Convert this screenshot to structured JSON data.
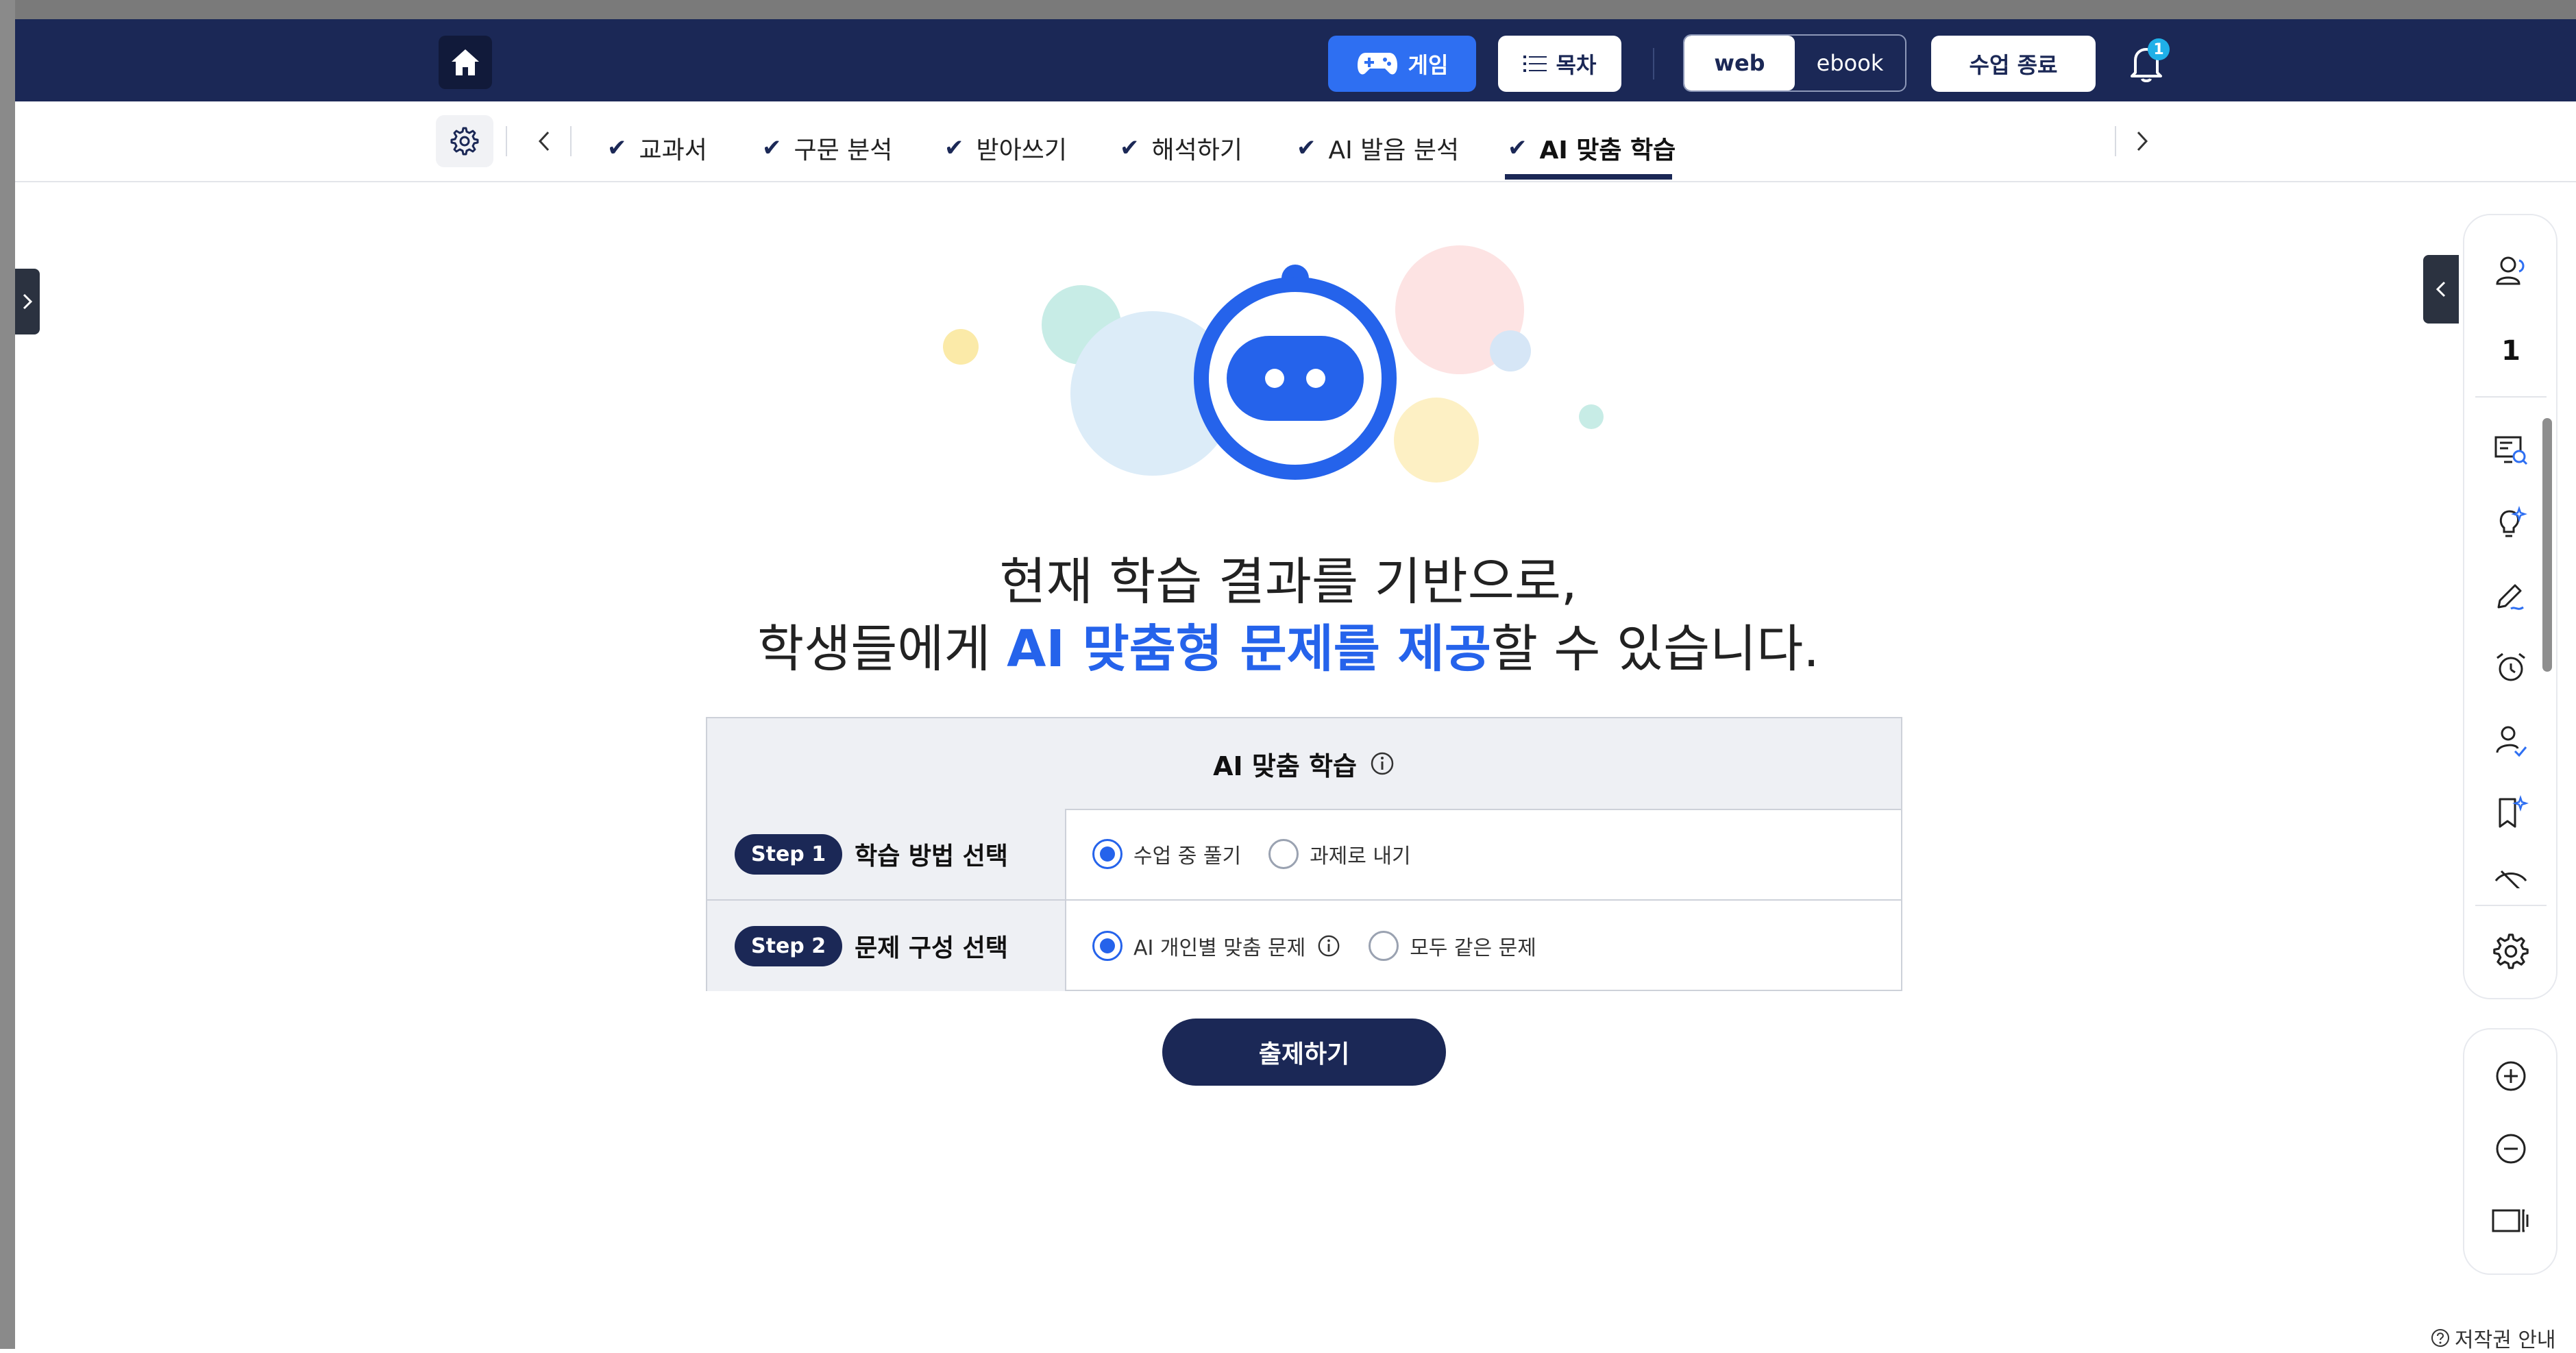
{
  "topbar": {
    "game_label": "게임",
    "toc_label": "목차",
    "mode_web": "web",
    "mode_ebook": "ebook",
    "end_class_label": "수업 종료",
    "notification_count": "1"
  },
  "tabs": [
    {
      "label": "교과서"
    },
    {
      "label": "구문 분석"
    },
    {
      "label": "받아쓰기"
    },
    {
      "label": "해석하기"
    },
    {
      "label": "AI 발음 분석"
    },
    {
      "label": "AI 맞춤 학습"
    }
  ],
  "active_tab_index": 5,
  "headline": {
    "line1": "현재 학습 결과를 기반으로,",
    "line2_prefix": "학생들에게 ",
    "line2_highlight": "AI 맞춤형 문제를 제공",
    "line2_suffix": "할 수 있습니다."
  },
  "panel": {
    "title": "AI 맞춤 학습",
    "rows": [
      {
        "step": "Step 1",
        "title": "학습 방법 선택",
        "options": [
          "수업 중 풀기",
          "과제로 내기"
        ],
        "selected": 0
      },
      {
        "step": "Step 2",
        "title": "문제 구성 선택",
        "options": [
          "AI 개인별 맞춤 문제",
          "모두 같은 문제"
        ],
        "selected": 0
      }
    ]
  },
  "submit_label": "출제하기",
  "rail": {
    "student_count": "1"
  },
  "copyright_label": "저작권 안내",
  "colors": {
    "navy": "#1b2856",
    "accent_blue": "#2563eb",
    "game_blue": "#2e6ff2",
    "badge": "#1fb0e8"
  }
}
